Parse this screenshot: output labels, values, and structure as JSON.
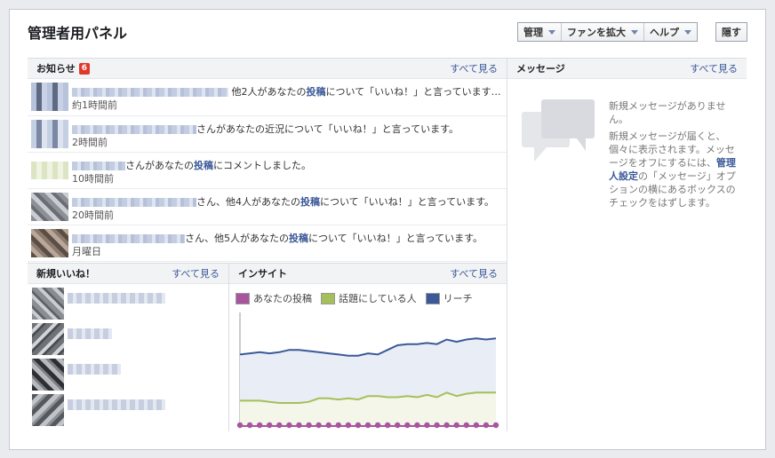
{
  "header": {
    "title": "管理者用パネル",
    "buttons": [
      {
        "label": "管理"
      },
      {
        "label": "ファンを拡大"
      },
      {
        "label": "ヘルプ"
      }
    ],
    "hide_label": "隠す"
  },
  "notifications": {
    "title": "お知らせ",
    "count": "6",
    "see_all": "すべて見る",
    "items": [
      {
        "text_before": "他2人があなたの",
        "link": "投稿",
        "text_after": "について「いいね！」と言っています…",
        "time": "約1時間前"
      },
      {
        "text_before": "さんがあなたの近況について「いいね！」と言っています。",
        "link": "",
        "text_after": "",
        "time": "2時間前"
      },
      {
        "text_before": "さんがあなたの",
        "link": "投稿",
        "text_after": "にコメントしました。",
        "time": "10時間前"
      },
      {
        "text_before": "さん、他4人があなたの",
        "link": "投稿",
        "text_after": "について「いいね！」と言っています。",
        "time": "20時間前"
      },
      {
        "text_before": "さん、他5人があなたの",
        "link": "投稿",
        "text_after": "について「いいね！」と言っています。",
        "time": "月曜日"
      }
    ]
  },
  "new_likes": {
    "title": "新規いいね！",
    "see_all": "すべて見る"
  },
  "insights": {
    "title": "インサイト",
    "see_all": "すべて見る",
    "legend": [
      {
        "label": "あなたの投稿",
        "color": "#a7559f"
      },
      {
        "label": "話題にしている人",
        "color": "#a6bf5b"
      },
      {
        "label": "リーチ",
        "color": "#3b5998"
      }
    ]
  },
  "chart_data": {
    "type": "line",
    "series": [
      {
        "name": "リーチ",
        "values": [
          62,
          63,
          64,
          63,
          64,
          66,
          66,
          65,
          64,
          63,
          62,
          61,
          61,
          63,
          62,
          66,
          70,
          71,
          71,
          72,
          71,
          75,
          73,
          75,
          76,
          75,
          76
        ]
      },
      {
        "name": "話題にしている人",
        "values": [
          22,
          22,
          22,
          21,
          20,
          20,
          20,
          21,
          24,
          24,
          23,
          24,
          23,
          26,
          26,
          25,
          25,
          26,
          25,
          27,
          25,
          29,
          26,
          28,
          29,
          29,
          29
        ]
      },
      {
        "name": "あなたの投稿",
        "values": [
          0,
          0,
          0,
          0,
          0,
          0,
          0,
          0,
          0,
          0,
          0,
          0,
          0,
          0,
          0,
          0,
          0,
          0,
          0,
          0,
          0,
          0,
          0,
          0,
          0,
          0,
          0
        ]
      }
    ],
    "ylim": [
      0,
      100
    ]
  },
  "messages": {
    "title": "メッセージ",
    "see_all": "すべて見る",
    "empty_line1": "新規メッセージがありません。",
    "body_before": "新規メッセージが届くと、個々に表示されます。メッセージをオフにするには、",
    "body_link": "管理人設定",
    "body_after": "の「メッセージ」オプションの横にあるボックスのチェックをはずします。"
  }
}
